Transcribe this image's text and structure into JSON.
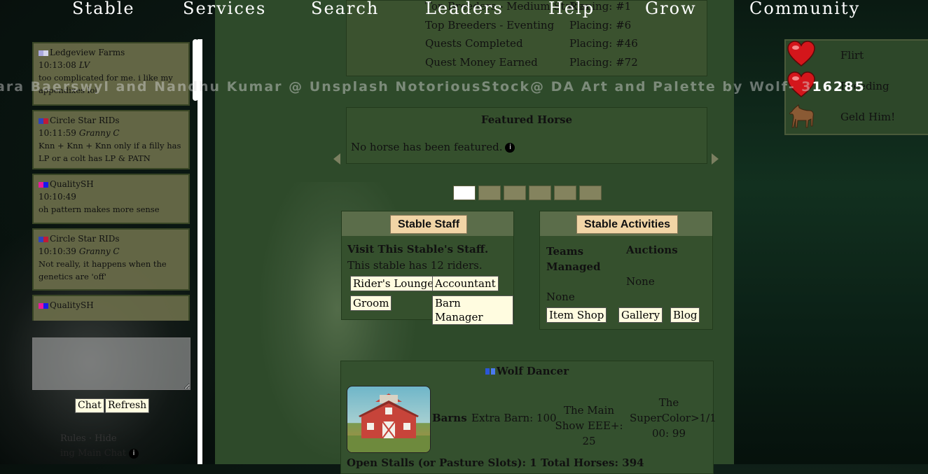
{
  "nav": [
    "Stable",
    "Services",
    "Search",
    "Leaders",
    "Help",
    "Grow",
    "Community"
  ],
  "credit_dim": "ara Baerswyl and Nandhu Kumar @ Unsplash NotoriousStock@ DA  Art and Palette by Wolf- 3",
  "credit_bright": "16285",
  "chat": {
    "messages": [
      {
        "user": "Ledgeview Farms",
        "flag": [
          "#b8b5ef",
          "#e6e6ff"
        ],
        "time": "10:13:08",
        "tag": "LV",
        "text": "too complicated for me. i like my appendixes lol"
      },
      {
        "user": "Circle Star RIDs",
        "flag": [
          "#3348c9",
          "#d01b3a"
        ],
        "time": "10:11:59",
        "tag": "Granny C",
        "text": "Knn + Knn + Knn only if a filly has LP or a colt has LP & PATN"
      },
      {
        "user": "QualitySH",
        "flag": [
          "#ff1aa6",
          "#1a1aff"
        ],
        "time": "10:10:49",
        "tag": "",
        "text": "oh pattern makes more sense"
      },
      {
        "user": "Circle Star RIDs",
        "flag": [
          "#3348c9",
          "#d01b3a"
        ],
        "time": "10:10:39",
        "tag": "Granny C",
        "text": "Not really, it happens when the genetics are 'off'"
      },
      {
        "user": "QualitySH",
        "flag": [
          "#ff1aa6",
          "#1a1aff"
        ],
        "time": "",
        "tag": "",
        "text": ""
      }
    ],
    "chat_button": "Chat",
    "refresh_button": "Refresh",
    "footer1": "Rules · Hide",
    "footer2": "ing Main Chat"
  },
  "stats": [
    {
      "label": "Top Breeders - Medium Stakes",
      "placing": "Placing: #1"
    },
    {
      "label": "Top Breeders - Eventing",
      "placing": "Placing: #6"
    },
    {
      "label": "Quests Completed",
      "placing": "Placing: #46"
    },
    {
      "label": "Quest Money Earned",
      "placing": "Placing: #72"
    }
  ],
  "featured": {
    "title": "Featured Horse",
    "message": "No horse has been featured."
  },
  "staff": {
    "title": "Stable Staff",
    "heading": "Visit This Stable's Staff.",
    "riders": "This stable has 12 riders.",
    "buttons": [
      "Rider's Lounge",
      "Accountant",
      "Groom",
      "Barn Manager"
    ]
  },
  "activities": {
    "title": "Stable Activities",
    "teams_label": "Teams Managed",
    "teams_value": "None",
    "auctions_label": "Auctions",
    "auctions_value": "None",
    "buttons": [
      "Item Shop",
      "Gallery",
      "Blog"
    ]
  },
  "horse_card": {
    "name": "Wolf Dancer",
    "barns": "Barns",
    "extra_barn": "Extra Barn: 100",
    "show": "The Main Show EEE+: 25",
    "supercolor": "The SuperColor>1/1 00: 99",
    "footer": "Open Stalls (or Pasture Slots): 1    Total Horses: 394"
  },
  "actions": [
    "Flirt",
    "Breeding",
    "Geld Him!"
  ]
}
